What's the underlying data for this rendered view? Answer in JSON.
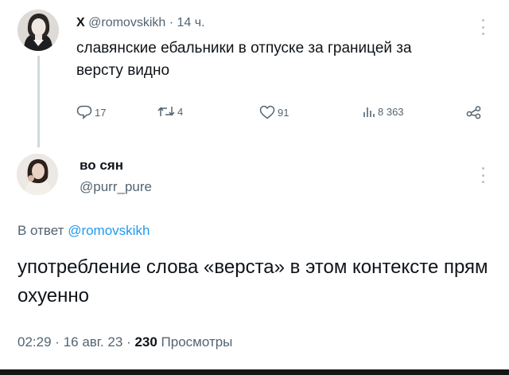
{
  "parent_tweet": {
    "name": "X",
    "handle": "@romovskikh",
    "separator": "·",
    "time": "14 ч.",
    "text": "славянские ебальники в отпуске за границей за версту видно",
    "stats": {
      "replies": "17",
      "retweets": "4",
      "likes": "91",
      "views": "8 363"
    }
  },
  "reply_tweet": {
    "name": "во сян",
    "handle": "@purr_pure",
    "reply_prefix": "В ответ",
    "reply_handle": "@romovskikh",
    "text": "употребление слова «верста» в этом контексте прям охуенно",
    "time": "02:29",
    "separator": "·",
    "date": "16 авг. 23",
    "views_count": "230",
    "views_label": "Просмотры"
  },
  "colors": {
    "text": "#0f1419",
    "muted": "#536471",
    "link": "#1d9bf0",
    "thread_line": "#cfd9de"
  },
  "icons": [
    "reply-icon",
    "retweet-icon",
    "like-icon",
    "views-icon",
    "share-icon",
    "more-icon"
  ]
}
